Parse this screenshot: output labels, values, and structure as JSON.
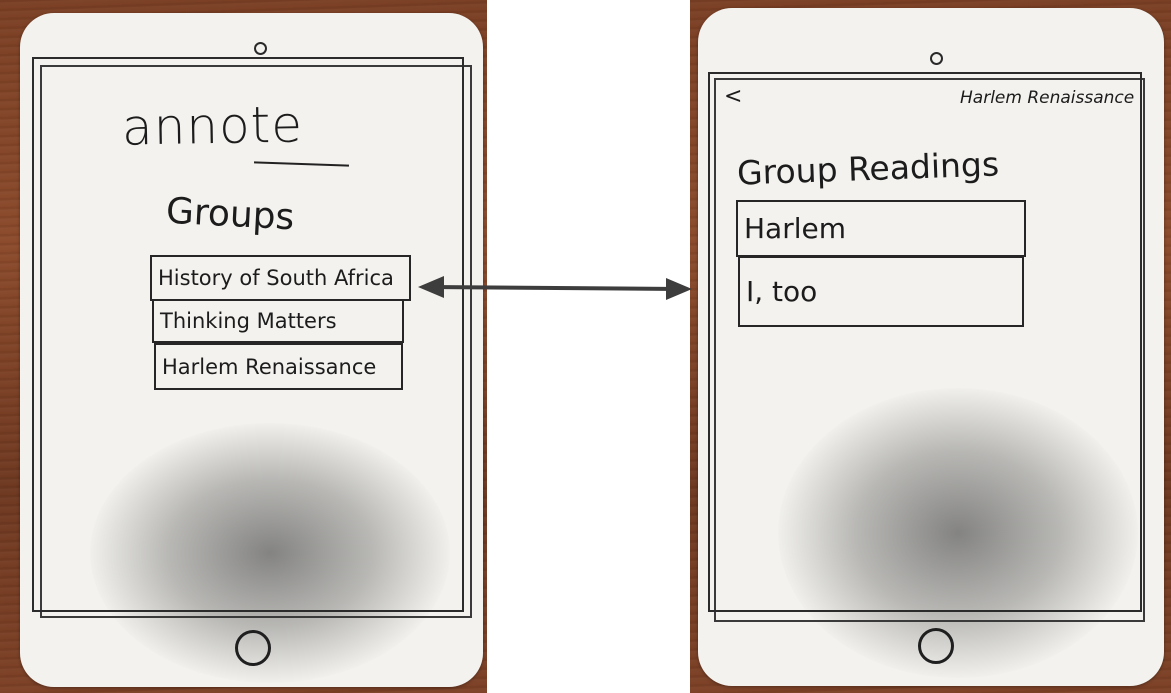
{
  "left_screen": {
    "logo": "annote",
    "groups_title": "Groups",
    "groups": [
      {
        "label": "History of South Africa"
      },
      {
        "label": "Thinking Matters"
      },
      {
        "label": "Harlem Renaissance"
      }
    ]
  },
  "right_screen": {
    "back_label": "<",
    "nav_title": "Harlem Renaissance",
    "section_title": "Group Readings",
    "readings": [
      {
        "label": "Harlem"
      },
      {
        "label": "I, too"
      }
    ]
  },
  "colors": {
    "paper": "#f3f2ee",
    "ink": "#1c1c1c",
    "wood": "#7a3f24"
  }
}
